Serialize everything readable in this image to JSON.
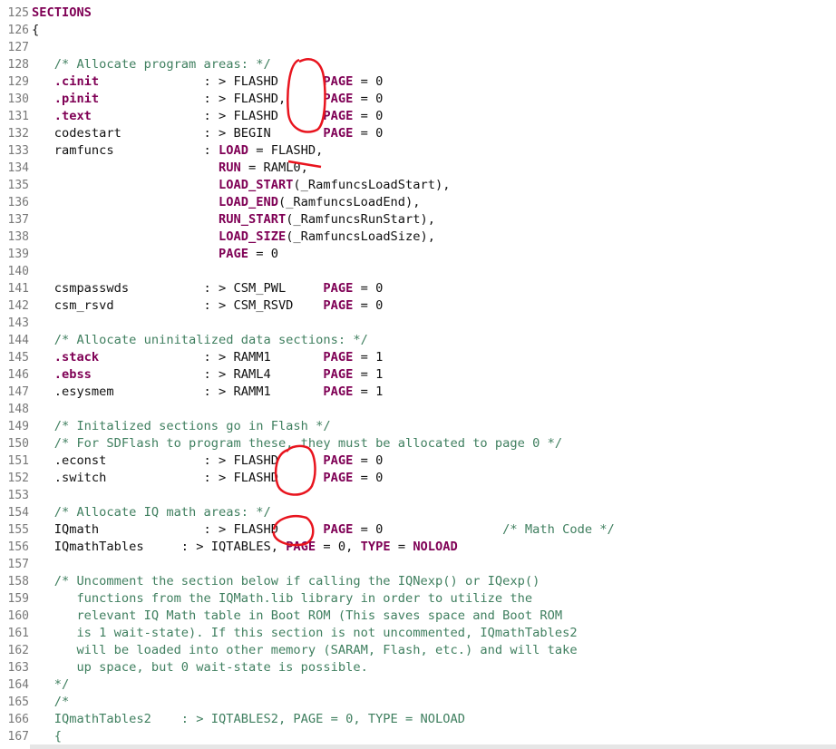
{
  "editor": {
    "lines": [
      {
        "n": "125",
        "t": [
          {
            "s": "SECTIONS",
            "k": "keyword"
          }
        ]
      },
      {
        "n": "126",
        "t": [
          {
            "s": "{",
            "k": "plain"
          }
        ]
      },
      {
        "n": "127",
        "t": []
      },
      {
        "n": "128",
        "t": [
          {
            "s": "   /* Allocate program areas: */",
            "k": "comment"
          }
        ]
      },
      {
        "n": "129",
        "t": [
          {
            "s": "   .cinit",
            "k": "keyword"
          },
          {
            "s": "              : > FLASHD      ",
            "k": "plain"
          },
          {
            "s": "PAGE",
            "k": "keyword"
          },
          {
            "s": " = 0",
            "k": "plain"
          }
        ]
      },
      {
        "n": "130",
        "t": [
          {
            "s": "   .pinit",
            "k": "keyword"
          },
          {
            "s": "              : > FLASHD,     ",
            "k": "plain"
          },
          {
            "s": "PAGE",
            "k": "keyword"
          },
          {
            "s": " = 0",
            "k": "plain"
          }
        ]
      },
      {
        "n": "131",
        "t": [
          {
            "s": "   .text",
            "k": "keyword"
          },
          {
            "s": "               : > FLASHD      ",
            "k": "plain"
          },
          {
            "s": "PAGE",
            "k": "keyword"
          },
          {
            "s": " = 0",
            "k": "plain"
          }
        ]
      },
      {
        "n": "132",
        "t": [
          {
            "s": "   codestart           : > BEGIN       ",
            "k": "plain"
          },
          {
            "s": "PAGE",
            "k": "keyword"
          },
          {
            "s": " = 0",
            "k": "plain"
          }
        ]
      },
      {
        "n": "133",
        "t": [
          {
            "s": "   ramfuncs            : ",
            "k": "plain"
          },
          {
            "s": "LOAD",
            "k": "keyword"
          },
          {
            "s": " = FLASHD,",
            "k": "plain"
          }
        ]
      },
      {
        "n": "134",
        "t": [
          {
            "s": "                         ",
            "k": "plain"
          },
          {
            "s": "RUN",
            "k": "keyword"
          },
          {
            "s": " = RAML0,",
            "k": "plain"
          }
        ]
      },
      {
        "n": "135",
        "t": [
          {
            "s": "                         ",
            "k": "plain"
          },
          {
            "s": "LOAD_START",
            "k": "keyword"
          },
          {
            "s": "(_RamfuncsLoadStart),",
            "k": "plain"
          }
        ]
      },
      {
        "n": "136",
        "t": [
          {
            "s": "                         ",
            "k": "plain"
          },
          {
            "s": "LOAD_END",
            "k": "keyword"
          },
          {
            "s": "(_RamfuncsLoadEnd),",
            "k": "plain"
          }
        ]
      },
      {
        "n": "137",
        "t": [
          {
            "s": "                         ",
            "k": "plain"
          },
          {
            "s": "RUN_START",
            "k": "keyword"
          },
          {
            "s": "(_RamfuncsRunStart),",
            "k": "plain"
          }
        ]
      },
      {
        "n": "138",
        "t": [
          {
            "s": "                         ",
            "k": "plain"
          },
          {
            "s": "LOAD_SIZE",
            "k": "keyword"
          },
          {
            "s": "(_RamfuncsLoadSize),",
            "k": "plain"
          }
        ]
      },
      {
        "n": "139",
        "t": [
          {
            "s": "                         ",
            "k": "plain"
          },
          {
            "s": "PAGE",
            "k": "keyword"
          },
          {
            "s": " = 0",
            "k": "plain"
          }
        ]
      },
      {
        "n": "140",
        "t": []
      },
      {
        "n": "141",
        "t": [
          {
            "s": "   csmpasswds          : > CSM_PWL     ",
            "k": "plain"
          },
          {
            "s": "PAGE",
            "k": "keyword"
          },
          {
            "s": " = 0",
            "k": "plain"
          }
        ]
      },
      {
        "n": "142",
        "t": [
          {
            "s": "   csm_rsvd            : > CSM_RSVD    ",
            "k": "plain"
          },
          {
            "s": "PAGE",
            "k": "keyword"
          },
          {
            "s": " = 0",
            "k": "plain"
          }
        ]
      },
      {
        "n": "143",
        "t": []
      },
      {
        "n": "144",
        "t": [
          {
            "s": "   /* Allocate uninitalized data sections: */",
            "k": "comment"
          }
        ]
      },
      {
        "n": "145",
        "t": [
          {
            "s": "   .stack",
            "k": "keyword"
          },
          {
            "s": "              : > RAMM1       ",
            "k": "plain"
          },
          {
            "s": "PAGE",
            "k": "keyword"
          },
          {
            "s": " = 1",
            "k": "plain"
          }
        ]
      },
      {
        "n": "146",
        "t": [
          {
            "s": "   .ebss",
            "k": "keyword"
          },
          {
            "s": "               : > RAML4       ",
            "k": "plain"
          },
          {
            "s": "PAGE",
            "k": "keyword"
          },
          {
            "s": " = 1",
            "k": "plain"
          }
        ]
      },
      {
        "n": "147",
        "t": [
          {
            "s": "   .esysmem            : > RAMM1       ",
            "k": "plain"
          },
          {
            "s": "PAGE",
            "k": "keyword"
          },
          {
            "s": " = 1",
            "k": "plain"
          }
        ]
      },
      {
        "n": "148",
        "t": []
      },
      {
        "n": "149",
        "t": [
          {
            "s": "   /* Initalized sections go in Flash */",
            "k": "comment"
          }
        ]
      },
      {
        "n": "150",
        "t": [
          {
            "s": "   /* For SDFlash to program these, they must be allocated to page 0 */",
            "k": "comment"
          }
        ]
      },
      {
        "n": "151",
        "t": [
          {
            "s": "   .econst             : > FLASHD      ",
            "k": "plain"
          },
          {
            "s": "PAGE",
            "k": "keyword"
          },
          {
            "s": " = 0",
            "k": "plain"
          }
        ]
      },
      {
        "n": "152",
        "t": [
          {
            "s": "   .switch             : > FLASHD      ",
            "k": "plain"
          },
          {
            "s": "PAGE",
            "k": "keyword"
          },
          {
            "s": " = 0",
            "k": "plain"
          }
        ]
      },
      {
        "n": "153",
        "t": []
      },
      {
        "n": "154",
        "t": [
          {
            "s": "   /* Allocate IQ math areas: */",
            "k": "comment"
          }
        ]
      },
      {
        "n": "155",
        "t": [
          {
            "s": "   IQmath              : > FLASHD      ",
            "k": "plain"
          },
          {
            "s": "PAGE",
            "k": "keyword"
          },
          {
            "s": " = 0                ",
            "k": "plain"
          },
          {
            "s": "/* Math Code */",
            "k": "comment"
          }
        ]
      },
      {
        "n": "156",
        "t": [
          {
            "s": "   IQmathTables     : > IQTABLES, ",
            "k": "plain"
          },
          {
            "s": "PAGE",
            "k": "keyword"
          },
          {
            "s": " = 0, ",
            "k": "plain"
          },
          {
            "s": "TYPE",
            "k": "keyword"
          },
          {
            "s": " = ",
            "k": "plain"
          },
          {
            "s": "NOLOAD",
            "k": "keyword"
          }
        ]
      },
      {
        "n": "157",
        "t": []
      },
      {
        "n": "158",
        "t": [
          {
            "s": "   /* Uncomment the section below if calling the IQNexp() or IQexp()",
            "k": "comment"
          }
        ]
      },
      {
        "n": "159",
        "t": [
          {
            "s": "      functions from the IQMath.lib library in order to utilize the",
            "k": "comment"
          }
        ]
      },
      {
        "n": "160",
        "t": [
          {
            "s": "      relevant IQ Math table in Boot ROM (This saves space and Boot ROM",
            "k": "comment"
          }
        ]
      },
      {
        "n": "161",
        "t": [
          {
            "s": "      is 1 wait-state). If this section is not uncommented, IQmathTables2",
            "k": "comment"
          }
        ]
      },
      {
        "n": "162",
        "t": [
          {
            "s": "      will be loaded into other memory (SARAM, Flash, etc.) and will take",
            "k": "comment"
          }
        ]
      },
      {
        "n": "163",
        "t": [
          {
            "s": "      up space, but 0 wait-state is possible.",
            "k": "comment"
          }
        ]
      },
      {
        "n": "164",
        "t": [
          {
            "s": "   */",
            "k": "comment"
          }
        ]
      },
      {
        "n": "165",
        "t": [
          {
            "s": "   /*",
            "k": "comment"
          }
        ]
      },
      {
        "n": "166",
        "t": [
          {
            "s": "   IQmathTables2    : > IQTABLES2, PAGE = 0, TYPE = NOLOAD",
            "k": "comment"
          }
        ]
      },
      {
        "n": "167",
        "t": [
          {
            "s": "   {",
            "k": "comment"
          }
        ]
      }
    ]
  },
  "colors": {
    "comment": "#3f7f5f",
    "keyword": "#7f0055",
    "line_number": "#787878",
    "annotation": "#e8141e"
  },
  "annotations": [
    {
      "kind": "circle-mark",
      "name": "red-circle-flashd-129-131"
    },
    {
      "kind": "underline-mark",
      "name": "red-underline-flashd-133"
    },
    {
      "kind": "circle-mark",
      "name": "red-circle-flashd-151-152"
    },
    {
      "kind": "circle-mark",
      "name": "red-circle-flashd-155"
    }
  ]
}
